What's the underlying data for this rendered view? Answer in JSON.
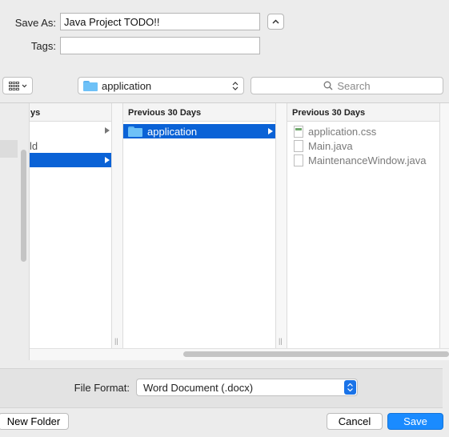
{
  "save_as": {
    "label": "Save As:",
    "value": "Java Project TODO!!"
  },
  "tags": {
    "label": "Tags:",
    "value": ""
  },
  "toolbar": {
    "location": "application",
    "search_placeholder": "Search"
  },
  "columns": [
    {
      "header": "ys",
      "rows": [
        "",
        "ld",
        ""
      ]
    },
    {
      "header": "Previous 30 Days",
      "rows": [
        "application"
      ]
    },
    {
      "header": "Previous 30 Days",
      "rows": [
        "application.css",
        "Main.java",
        "MaintenanceWindow.java"
      ]
    }
  ],
  "format": {
    "label": "File Format:",
    "value": "Word Document (.docx)"
  },
  "buttons": {
    "new_folder": "New Folder",
    "cancel": "Cancel",
    "save": "Save"
  },
  "colors": {
    "selection": "#0a62d6",
    "primary": "#1a8bff",
    "folder": "#6ec1f7"
  },
  "icons": [
    "chevron-up-icon",
    "grid-view-icon",
    "chevron-down-icon",
    "folder-icon",
    "updown-icon",
    "search-icon",
    "file-icon",
    "disclosure-arrow-icon"
  ]
}
